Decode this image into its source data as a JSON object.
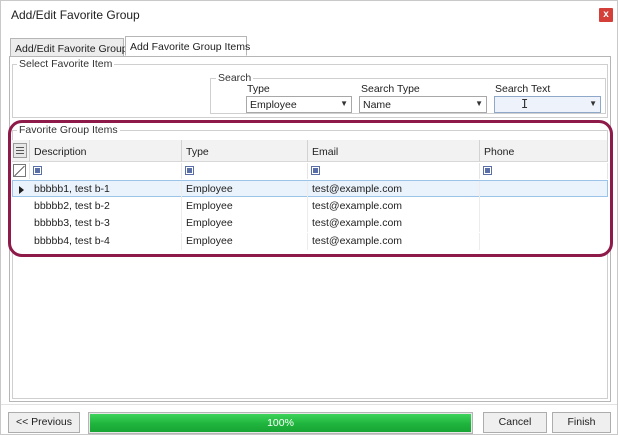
{
  "window": {
    "title": "Add/Edit Favorite Group",
    "close_glyph": "x"
  },
  "tabs": [
    {
      "label": "Add/Edit Favorite Group",
      "active": false
    },
    {
      "label": "Add Favorite Group Items",
      "active": true
    }
  ],
  "select_group": {
    "legend": "Select Favorite Item",
    "search_label": "Search",
    "type": {
      "label": "Type",
      "value": "Employee"
    },
    "search_type": {
      "label": "Search Type",
      "value": "Name"
    },
    "search_text": {
      "label": "Search Text",
      "value": ""
    }
  },
  "items_group": {
    "legend": "Favorite Group Items",
    "columns": [
      "Description",
      "Type",
      "Email",
      "Phone"
    ],
    "rows": [
      {
        "description": "bbbbb1, test b-1",
        "type": "Employee",
        "email": "test@example.com",
        "phone": "",
        "selected": true
      },
      {
        "description": "bbbbb2, test b-2",
        "type": "Employee",
        "email": "test@example.com",
        "phone": "",
        "selected": false
      },
      {
        "description": "bbbbb3, test b-3",
        "type": "Employee",
        "email": "test@example.com",
        "phone": "",
        "selected": false
      },
      {
        "description": "bbbbb4, test b-4",
        "type": "Employee",
        "email": "test@example.com",
        "phone": "",
        "selected": false
      }
    ]
  },
  "footer": {
    "previous_label": "<< Previous",
    "progress_percent": 100,
    "progress_text": "100%",
    "cancel_label": "Cancel",
    "finish_label": "Finish"
  },
  "colors": {
    "highlight_ring": "#8e1a4a",
    "progress_green": "#1fb43d",
    "close_red": "#d43f3a",
    "selection": "#eaf2fb"
  },
  "icons": {
    "close": "close-icon",
    "dropdown": "chevron-down-icon",
    "column_chooser": "column-chooser-icon",
    "filter_clear": "filter-clear-icon",
    "row_indicator": "row-indicator-icon",
    "filter_cell": "filter-checkbox-icon"
  }
}
